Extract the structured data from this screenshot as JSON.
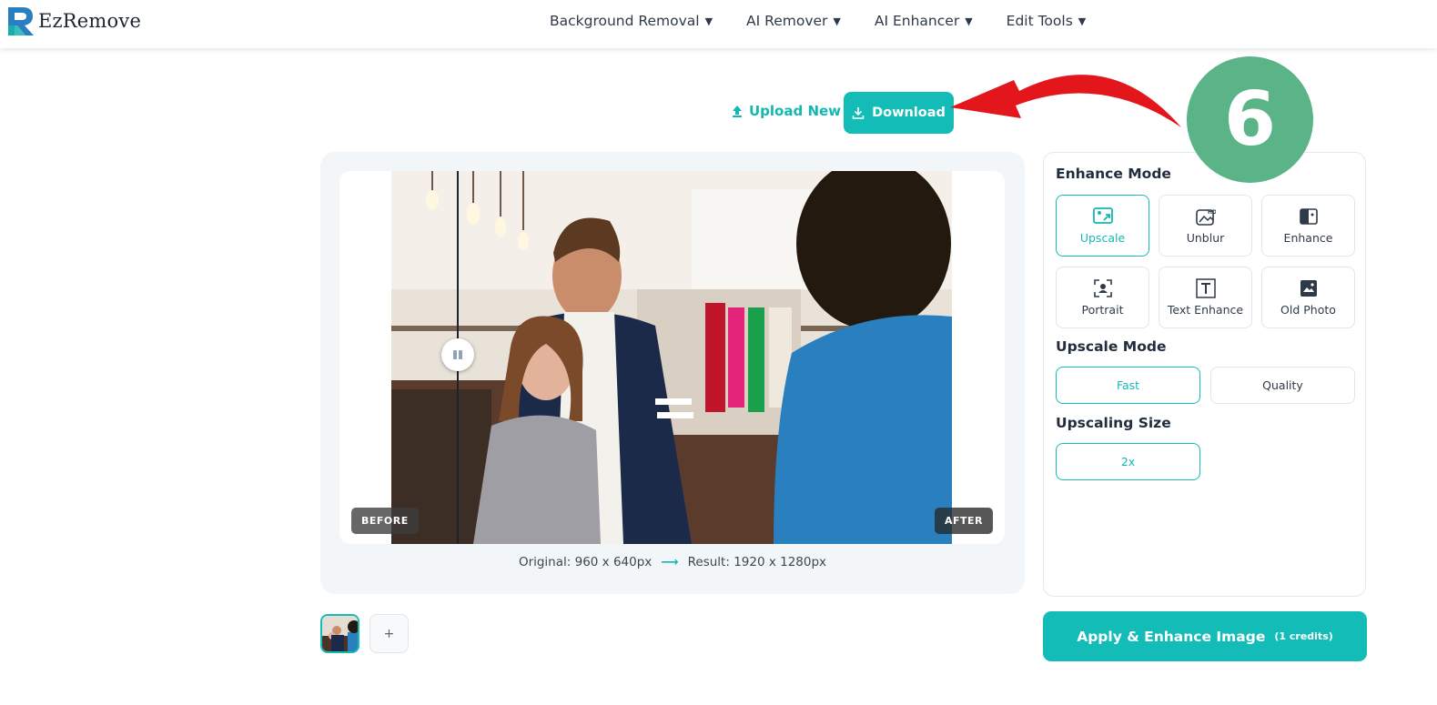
{
  "brand": {
    "name": "EzRemove"
  },
  "nav": {
    "items": [
      {
        "label": "Background Removal"
      },
      {
        "label": "AI Remover"
      },
      {
        "label": "AI Enhancer"
      },
      {
        "label": "Edit Tools"
      }
    ]
  },
  "actions": {
    "upload_label": "Upload New",
    "download_label": "Download"
  },
  "annotation": {
    "step": "6"
  },
  "preview": {
    "before_label": "BEFORE",
    "after_label": "AFTER",
    "original": "Original: 960 x 640px",
    "result": "Result: 1920 x 1280px",
    "arrow": "⟶",
    "add_label": "+"
  },
  "settings": {
    "enhance_mode_title": "Enhance Mode",
    "modes": [
      {
        "label": "Upscale",
        "active": true
      },
      {
        "label": "Unblur",
        "active": false
      },
      {
        "label": "Enhance",
        "active": false
      },
      {
        "label": "Portrait",
        "active": false
      },
      {
        "label": "Text Enhance",
        "active": false
      },
      {
        "label": "Old Photo",
        "active": false
      }
    ],
    "upscale_mode_title": "Upscale Mode",
    "upscale_modes": [
      {
        "label": "Fast",
        "active": true
      },
      {
        "label": "Quality",
        "active": false
      }
    ],
    "upscaling_size_title": "Upscaling Size",
    "sizes": [
      {
        "label": "2x",
        "active": true
      }
    ]
  },
  "apply": {
    "label": "Apply & Enhance Image",
    "credits": "(1 credits)"
  },
  "colors": {
    "accent": "#14bcb7",
    "annotation_arrow": "#e3161c",
    "badge": "#5ab488"
  }
}
